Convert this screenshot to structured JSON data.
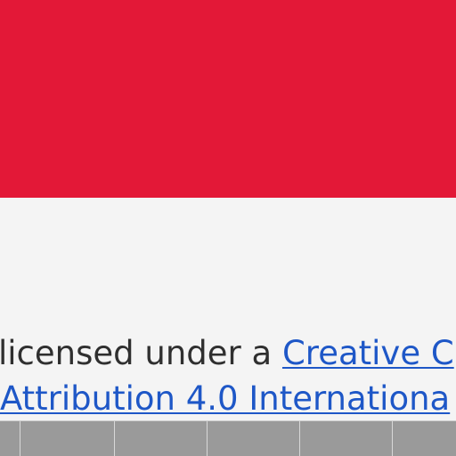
{
  "colors": {
    "banner": "#e31837",
    "page_background": "#f4f4f4",
    "text": "#2f2f2f",
    "link": "#1e57c7",
    "strip_cell": "#9a9a9a"
  },
  "license": {
    "prefix": "licensed under a ",
    "link_line_1": "Creative C",
    "link_line_2": "Attribution 4.0 Internationa"
  },
  "footer_strip": {
    "cell_count": 6
  }
}
